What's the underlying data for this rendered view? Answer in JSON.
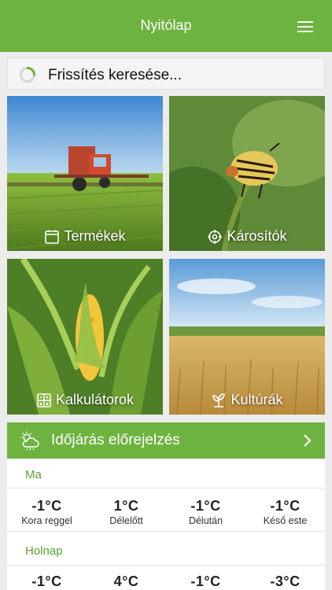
{
  "header": {
    "title": "Nyitólap",
    "menu_icon": "hamburger-menu-icon"
  },
  "refresh": {
    "text": "Frissítés keresése..."
  },
  "tiles": [
    {
      "label": "Termékek",
      "icon": "clipboard-icon"
    },
    {
      "label": "Károsítók",
      "icon": "crosshair-icon"
    },
    {
      "label": "Kalkulátorok",
      "icon": "calculator-icon"
    },
    {
      "label": "Kultúrák",
      "icon": "sprout-icon"
    }
  ],
  "weather": {
    "title": "Időjárás előrejelzés",
    "icon": "cloud-sun-icon",
    "days": [
      {
        "label": "Ma",
        "forecasts": [
          {
            "temp": "-1°C",
            "part": "Kora reggel"
          },
          {
            "temp": "1°C",
            "part": "Délelőtt"
          },
          {
            "temp": "-1°C",
            "part": "Délután"
          },
          {
            "temp": "-1°C",
            "part": "Késő este"
          }
        ]
      },
      {
        "label": "Holnap",
        "forecasts": [
          {
            "temp": "-1°C"
          },
          {
            "temp": "4°C"
          },
          {
            "temp": "-1°C"
          },
          {
            "temp": "-3°C"
          }
        ]
      }
    ]
  },
  "colors": {
    "brand_green": "#6db33f",
    "day_label_green": "#5aa232",
    "background": "#ececec"
  }
}
